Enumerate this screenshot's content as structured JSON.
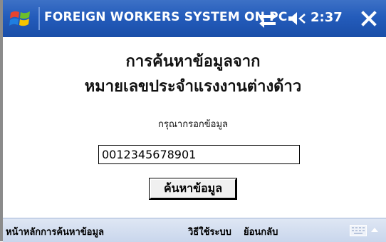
{
  "titlebar": {
    "title": "FOREIGN WORKERS SYSTEM ON PC",
    "clock": "2:37",
    "icons": {
      "start": "windows-flag-icon",
      "connectivity": "connectivity-icon",
      "volume": "volume-icon",
      "close": "close-icon"
    }
  },
  "content": {
    "heading_line1": "การค้นหาข้อมูลจาก",
    "heading_line2": "หมายเลขประจำแรงงานต่างด้าว",
    "prompt": "กรุณากรอกข้อมูล",
    "input_value": "0012345678901",
    "search_button": "ค้นหาข้อมูล"
  },
  "menubar": {
    "items": [
      "หน้าหลักการค้นหาข้อมูล",
      "วิธีใช้ระบบ",
      "ย้อนกลับ"
    ],
    "icons": {
      "keyboard": "keyboard-icon",
      "arrow": "sip-up-arrow-icon"
    }
  },
  "colors": {
    "titlebar": "#245cbb",
    "menubar": "#c9d6ec",
    "background": "#ffffff"
  }
}
